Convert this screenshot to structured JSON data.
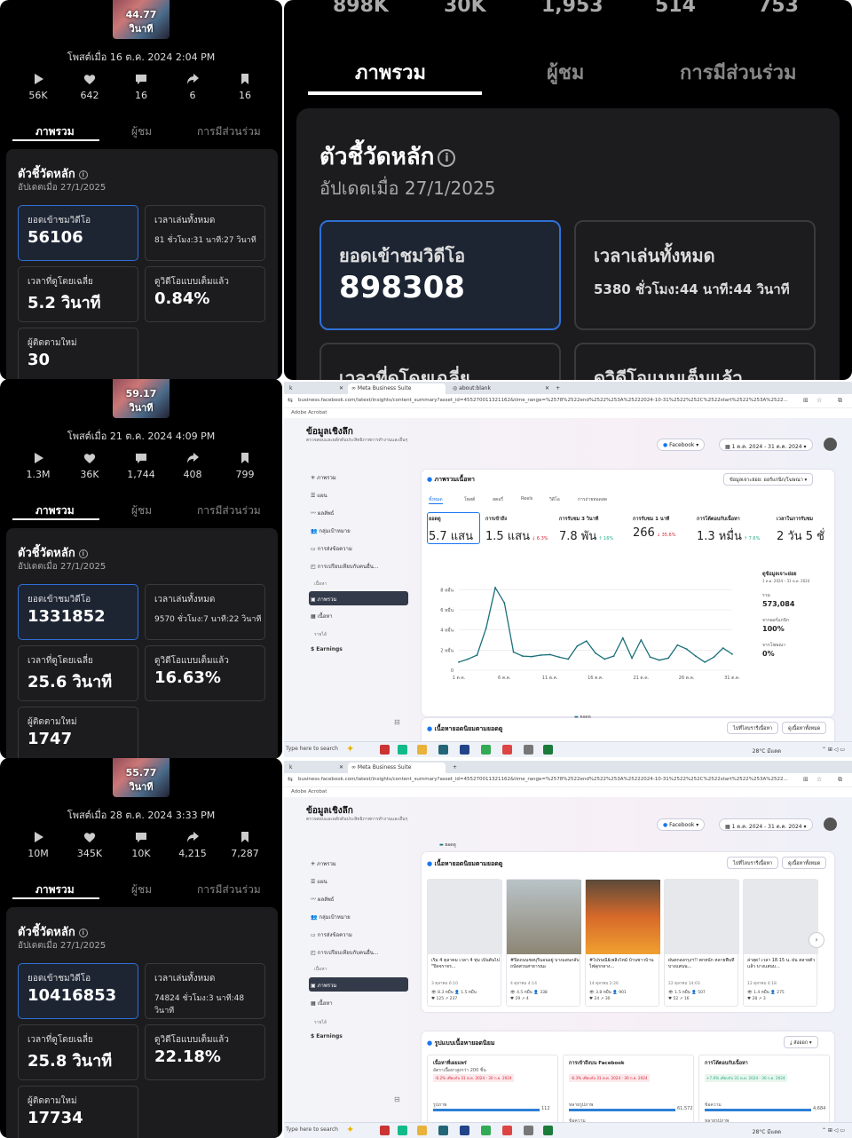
{
  "panels": [
    {
      "duration": "44.77 วินาที",
      "posted": "โพสต์เมื่อ 16 ต.ค. 2024 2:04 PM",
      "stats": [
        "56K",
        "642",
        "16",
        "6",
        "16"
      ],
      "tabs": [
        "ภาพรวม",
        "ผู้ชม",
        "การมีส่วนร่วม"
      ],
      "card_title": "ตัวชี้วัดหลัก",
      "card_updated": "อัปเดตเมื่อ 27/1/2025",
      "metrics": {
        "views_label": "ยอดเข้าชมวิดีโอ",
        "views": "56106",
        "playtime_label": "เวลาเล่นทั้งหมด",
        "playtime": "81 ชั่วโมง:31 นาที:27 วินาที",
        "avg_label": "เวลาที่ดูโดยเฉลี่ย",
        "avg": "5.2 วินาที",
        "full_label": "ดูวิดีโอแบบเต็มแล้ว",
        "full": "0.84%",
        "followers_label": "ผู้ติดตามใหม่",
        "followers": "30"
      }
    },
    {
      "duration": "59.17 วินาที",
      "posted": "โพสต์เมื่อ 21 ต.ค. 2024 4:09 PM",
      "stats": [
        "1.3M",
        "36K",
        "1,744",
        "408",
        "799"
      ],
      "tabs": [
        "ภาพรวม",
        "ผู้ชม",
        "การมีส่วนร่วม"
      ],
      "card_title": "ตัวชี้วัดหลัก",
      "card_updated": "อัปเดตเมื่อ 27/1/2025",
      "metrics": {
        "views_label": "ยอดเข้าชมวิดีโอ",
        "views": "1331852",
        "playtime_label": "เวลาเล่นทั้งหมด",
        "playtime": "9570 ชั่วโมง:7 นาที:22 วินาที",
        "avg_label": "เวลาที่ดูโดยเฉลี่ย",
        "avg": "25.6 วินาที",
        "full_label": "ดูวิดีโอแบบเต็มแล้ว",
        "full": "16.63%",
        "followers_label": "ผู้ติดตามใหม่",
        "followers": "1747"
      }
    },
    {
      "duration": "55.77 วินาที",
      "posted": "โพสต์เมื่อ 28 ต.ค. 2024 3:33 PM",
      "stats": [
        "10M",
        "345K",
        "10K",
        "4,215",
        "7,287"
      ],
      "tabs": [
        "ภาพรวม",
        "ผู้ชม",
        "การมีส่วนร่วม"
      ],
      "card_title": "ตัวชี้วัดหลัก",
      "card_updated": "อัปเดตเมื่อ 27/1/2025",
      "metrics": {
        "views_label": "ยอดเข้าชมวิดีโอ",
        "views": "10416853",
        "playtime_label": "เวลาเล่นทั้งหมด",
        "playtime": "74824 ชั่วโมง:3 นาที:48 วินาที",
        "avg_label": "เวลาที่ดูโดยเฉลี่ย",
        "avg": "25.8 วินาที",
        "full_label": "ดูวิดีโอแบบเต็มแล้ว",
        "full": "22.18%",
        "followers_label": "ผู้ติดตามใหม่",
        "followers": "17734"
      }
    }
  ],
  "big": {
    "stats": [
      "898K",
      "30K",
      "1,953",
      "514",
      "753"
    ],
    "tabs": [
      "ภาพรวม",
      "ผู้ชม",
      "การมีส่วนร่วม"
    ],
    "card_title": "ตัวชี้วัดหลัก",
    "card_updated": "อัปเดตเมื่อ 27/1/2025",
    "views_label": "ยอดเข้าชมวิดีโอ",
    "views": "898308",
    "playtime_label": "เวลาเล่นทั้งหมด",
    "playtime": "5380 ชั่วโมง:44 นาที:44 วินาที",
    "avg_label": "เวลาที่ดูโดยเฉลี่ย",
    "full_label": "ดูวิดีโอแบบเต็มแล้ว"
  },
  "browser": {
    "tabs": [
      "Meta Business Suite",
      "about:blank"
    ],
    "url": "business.facebook.com/latest/insights/content_summary?asset_id=455270011321162&time_range=%2578%2522end%2522%253A%25222024-10-31%2522%252C%2522start%2522%253A%2522...",
    "bookmark": "Adobe Acrobat",
    "page_title": "ข้อมูลเชิงลึก",
    "page_subtitle": "ตรวจสอบและผลักดันประสิทธิภาพการทำงานและอื่นๆ",
    "platform": "Facebook",
    "date_range": "1 ต.ค. 2024 - 31 ต.ค. 2024",
    "sidebar": [
      "ภาพรวม",
      "แผน",
      "ผลลัพธ์",
      "กลุ่มเป้าหมาย",
      "การส่งข้อความ",
      "การเปรียบเทียบกับคนอื่น..."
    ],
    "sidebar_section": "เนื้อหา",
    "sidebar_content": [
      "ภาพรวม",
      "เนื้อหา"
    ],
    "sidebar_section2": "รายได้",
    "earnings": "Earnings",
    "overview_title": "ภาพรวมเนื้อหา",
    "filter": "ข้อมูลเจาะย่อย: ออร์แกนิก/โฆษณา",
    "content_tabs": [
      "ทั้งหมด",
      "โพสต์",
      "สตอรี่",
      "Reels",
      "วิดีโอ",
      "การถ่ายทอดสด"
    ],
    "metrics": [
      {
        "label": "ยอดดู",
        "value": "5.7 แสน",
        "change": ""
      },
      {
        "label": "การเข้าถึง",
        "value": "1.5 แสน",
        "change": "↓ 6.3%"
      },
      {
        "label": "การรับชม 3 วินาที",
        "value": "7.8 พัน",
        "change": "↑ 16%"
      },
      {
        "label": "การรับชม 1 นาที",
        "value": "266",
        "change": "↓ 35.6%"
      },
      {
        "label": "การโต้ตอบกับเนื้อหา",
        "value": "1.3 หมื่น",
        "change": "↑ 7.6%"
      },
      {
        "label": "เวลาในการรับชม",
        "value": "2 วัน 5 ชั่",
        "change": ""
      }
    ],
    "legend": "ยอดดู",
    "side_summary": {
      "title": "ดูข้อมูลเจาะย่อย",
      "date": "1 ต.ค. 2024 – 31 ต.ค. 2024",
      "total_label": "รวม",
      "total": "573,084",
      "organic_label": "จากออร์แกนิก",
      "organic": "100%",
      "ads_label": "จากโฆษณา",
      "ads": "0%"
    },
    "top_content_title": "เนื้อหายอดนิยมตามยอดดู",
    "goto_content": "ไปที่ไลบรารีเนื้อหา",
    "see_all": "ดูเนื้อหาทั้งหมด",
    "export": "ส่งออก",
    "videos": [
      {
        "title": "เริ่ม 4 ตุลาคม เวลา 4 ทุ่ม เป็นต้นไป \"ปิดจราจร...",
        "date": "3 ตุลาคม 6:10",
        "m1": "👁 8.3 หมื่น   👤 1.5 หมื่น",
        "m2": "♥ 125   ↗ 237"
      },
      {
        "title": "#ปิดถนนชลบุรีนอนอยู่ บางแสนกลับถนัดสวนสาธารณะ",
        "date": "4 ตุลาคม 4:14",
        "m1": "👁 4.5 หมื่น   👤 338",
        "m2": "♥ 29   ↗ 4"
      },
      {
        "title": "#ไปรษณีย์เพลิงไหม้ บ้านชาวบ้านไฟลุกกลาง...",
        "date": "14 ตุลาคม 2:26",
        "m1": "👁 3.8 หมื่น   👤 901",
        "m2": "♥ 24   ↗ 30"
      },
      {
        "title": "ฝนตกลงกรุงฯ!! ตกหนัก หลายพื้นที่ บางแสนน...",
        "date": "22 ตุลาคม 14:03",
        "m1": "👁 1.5 หมื่น   👤 507",
        "m2": "♥ 52   ↗ 16"
      },
      {
        "title": "ล่าสุด! เวลา 18.15 น. ฝน สลายตัวแล้ว บางแสนบ...",
        "date": "12 ตุลาคม 4:18",
        "m1": "👁 1.4 หมื่น   👤 275",
        "m2": "♥ 28   ↗ 3"
      }
    ],
    "formats_title": "รูปแบบเนื้อหายอดนิยม",
    "formats": [
      {
        "title": "เนื้อหาที่เผยแพร่",
        "sub": "อัตราเนื้อหาสูงกว่า 200 ชิ้น",
        "change": "-6.2% เทียบกับ 31 ต.ค. 2024 - 30 ก.ย. 2024",
        "row1": "รูปภาพ",
        "val1": "112"
      },
      {
        "title": "การเข้าถึงบน Facebook",
        "sub": "",
        "change": "-6.3% เทียบกับ 31 ต.ค. 2024 - 30 ก.ย. 2024",
        "row1": "หลายรูปภาพ",
        "val1": "61,572",
        "row2": "ข้อความ",
        "val2": "58,966"
      },
      {
        "title": "การโต้ตอบกับเนื้อหา",
        "sub": "",
        "change": "+7.6% เทียบกับ 31 ต.ค. 2024 - 30 ก.ย. 2024",
        "row1": "ข้อความ",
        "val1": "4,684",
        "row2": "หลายรูปภาพ",
        "val2": "4,505"
      }
    ],
    "search": "Type here to search",
    "weather": "28°C มีแดด"
  },
  "chart_data": {
    "type": "line",
    "x": [
      "1 ต.ค.",
      "2",
      "3",
      "4",
      "5",
      "6",
      "7",
      "8",
      "9",
      "10",
      "11",
      "12",
      "13",
      "14",
      "15",
      "16",
      "17",
      "18",
      "19",
      "20",
      "21",
      "22",
      "23",
      "24",
      "25",
      "26",
      "27",
      "28",
      "29",
      "30",
      "31"
    ],
    "x_tick_labels": [
      "1 ต.ค.",
      "6 ต.ค.",
      "11 ต.ค.",
      "16 ต.ค.",
      "21 ต.ค.",
      "26 ต.ค.",
      "31 ต.ค."
    ],
    "series": [
      {
        "name": "ยอดดู",
        "values": [
          8000,
          11000,
          15000,
          42000,
          82000,
          67000,
          18000,
          14000,
          13500,
          15000,
          15500,
          13000,
          11000,
          24000,
          29000,
          17000,
          11000,
          14000,
          32000,
          12000,
          30000,
          13000,
          10000,
          12000,
          25000,
          21000,
          14000,
          8000,
          13000,
          22000,
          16000
        ]
      }
    ],
    "y_tick_labels": [
      "0",
      "2 หมื่น",
      "4 หมื่น",
      "6 หมื่น",
      "8 หมื่น"
    ],
    "ylim": [
      0,
      90000
    ],
    "grid": true,
    "legend": "bottom"
  }
}
